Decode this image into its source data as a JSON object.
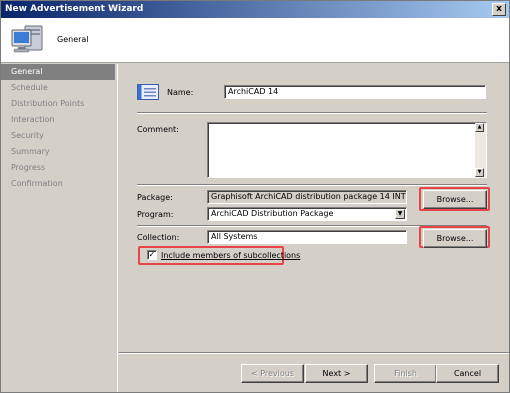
{
  "window": {
    "title": "New Advertisement Wizard",
    "close_glyph": "x"
  },
  "header": {
    "title": "General",
    "icon": "computer-monitor-icon"
  },
  "sidebar": {
    "items": [
      {
        "label": "General",
        "active": true
      },
      {
        "label": "Schedule"
      },
      {
        "label": "Distribution Points"
      },
      {
        "label": "Interaction"
      },
      {
        "label": "Security"
      },
      {
        "label": "Summary"
      },
      {
        "label": "Progress"
      },
      {
        "label": "Confirmation"
      }
    ]
  },
  "form": {
    "name_label": "Name:",
    "name_value": "ArchiCAD 14",
    "comment_label": "Comment:",
    "comment_value": "",
    "package_label": "Package:",
    "package_value": "Graphisoft ArchiCAD distribution package 14 INT",
    "package_browse": "Browse...",
    "program_label": "Program:",
    "program_value": "ArchiCAD Distribution Package",
    "collection_label": "Collection:",
    "collection_value": "All Systems",
    "collection_browse": "Browse...",
    "subcollections_label": "Include members of subcollections",
    "subcollections_checked": true
  },
  "footer": {
    "previous": "< Previous",
    "next": "Next >",
    "finish": "Finish",
    "cancel": "Cancel"
  },
  "colors": {
    "highlight": "#e8444a",
    "active_item_bg": "#808080"
  }
}
